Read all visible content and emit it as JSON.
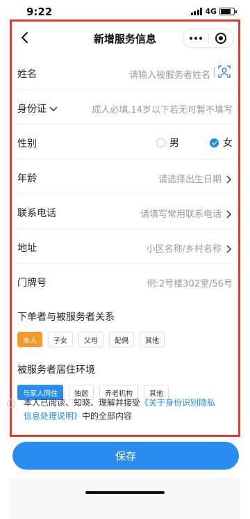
{
  "status": {
    "time": "9:22",
    "network": "4G",
    "battery_level": 0.8
  },
  "nav": {
    "title": "新增服务信息"
  },
  "form": {
    "name": {
      "label": "姓名",
      "placeholder": "请输入被服务者姓名"
    },
    "id_card": {
      "label": "身份证",
      "placeholder": "成人必填,14岁以下若无可暂不填写"
    },
    "gender": {
      "label": "性别",
      "male": "男",
      "female": "女",
      "selected": "女"
    },
    "age": {
      "label": "年龄",
      "placeholder": "请选择出生日期"
    },
    "phone": {
      "label": "联系电话",
      "placeholder": "请填写常用联系电话"
    },
    "address": {
      "label": "地址",
      "placeholder": "小区名称/乡村名称"
    },
    "door": {
      "label": "门牌号",
      "placeholder": "例:2号楼302室/56号"
    }
  },
  "relation": {
    "title": "下单者与被服务者关系",
    "options": [
      "本人",
      "子女",
      "父母",
      "配偶",
      "其他"
    ],
    "selected": "本人",
    "active_color": "#f29b2a"
  },
  "living": {
    "title": "被服务者居住环境",
    "options": [
      "与家人同住",
      "独居",
      "养老机构",
      "其他"
    ],
    "selected": "与家人同住",
    "active_color": "#2b8cf0"
  },
  "agreement": {
    "text_before": "本人已阅读、知晓、理解并接受",
    "link_text": "《关于身份识别隐私信息处理说明》",
    "text_after": "中的全部内容"
  },
  "save_button": {
    "label": "保存"
  }
}
